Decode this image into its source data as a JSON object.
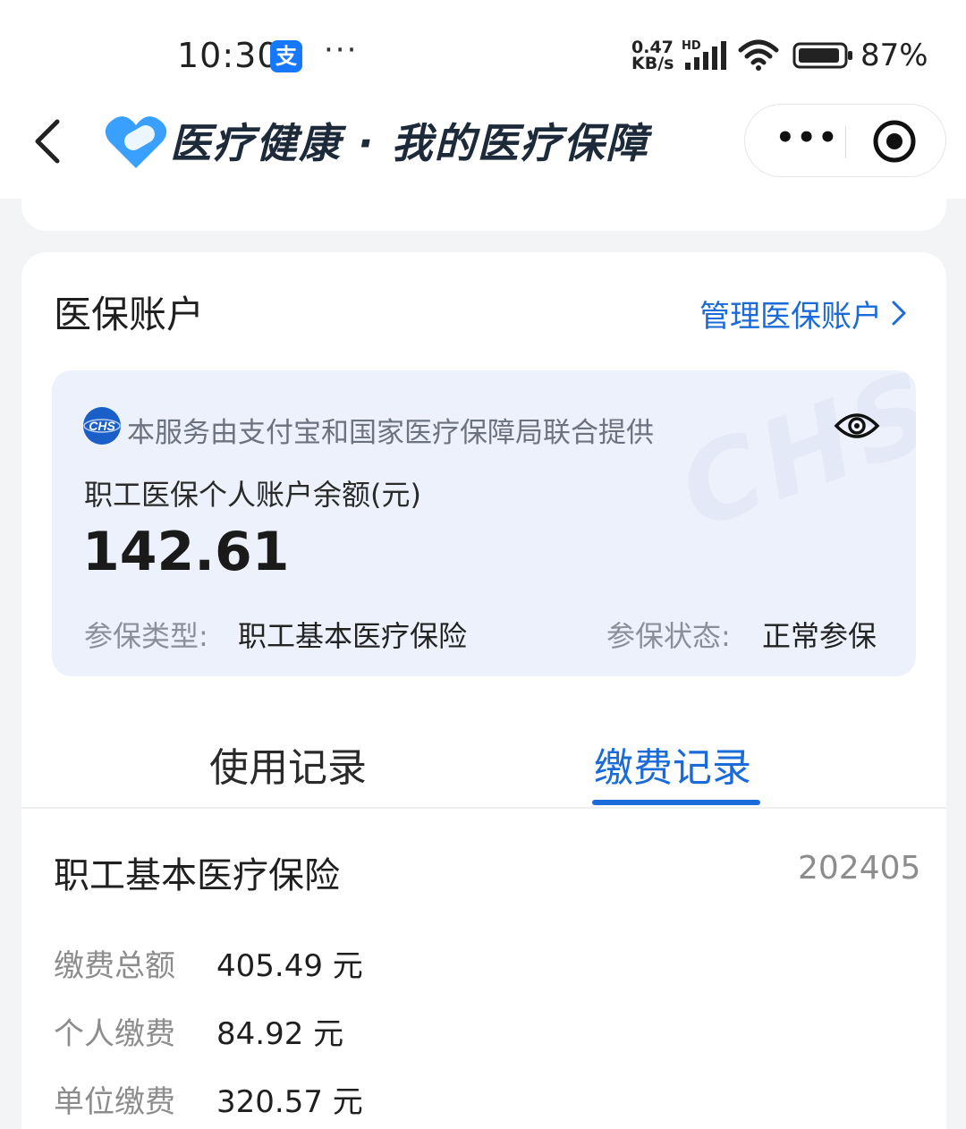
{
  "status_bar": {
    "time": "10:30",
    "alipay_badge": "支",
    "dots": "···",
    "net_speed_value": "0.47",
    "net_speed_unit": "KB/s",
    "hd": "HD",
    "battery_percent": "87%"
  },
  "nav": {
    "title": "医疗健康 · 我的医疗保障",
    "more_label": "•••"
  },
  "account": {
    "section_title": "医保账户",
    "manage_link": "管理医保账户",
    "provider_text": "本服务由支付宝和国家医疗保障局联合提供",
    "watermark": "CHS",
    "balance_label": "职工医保个人账户余额(元)",
    "balance_value": "142.61",
    "insurance_type_label": "参保类型:",
    "insurance_type_value": "职工基本医疗保险",
    "insurance_status_label": "参保状态:",
    "insurance_status_value": "正常参保"
  },
  "tabs": [
    {
      "label": "使用记录",
      "active": false
    },
    {
      "label": "缴费记录",
      "active": true
    }
  ],
  "record": {
    "title": "职工基本医疗保险",
    "period": "202405",
    "rows": [
      {
        "label": "缴费总额",
        "value": "405.49 元"
      },
      {
        "label": "个人缴费",
        "value": "84.92 元"
      },
      {
        "label": "单位缴费",
        "value": "320.57 元"
      }
    ]
  },
  "colors": {
    "accent": "#1a6bd8",
    "panel_bg": "#ecf1fb",
    "page_bg": "#f3f4f6"
  }
}
